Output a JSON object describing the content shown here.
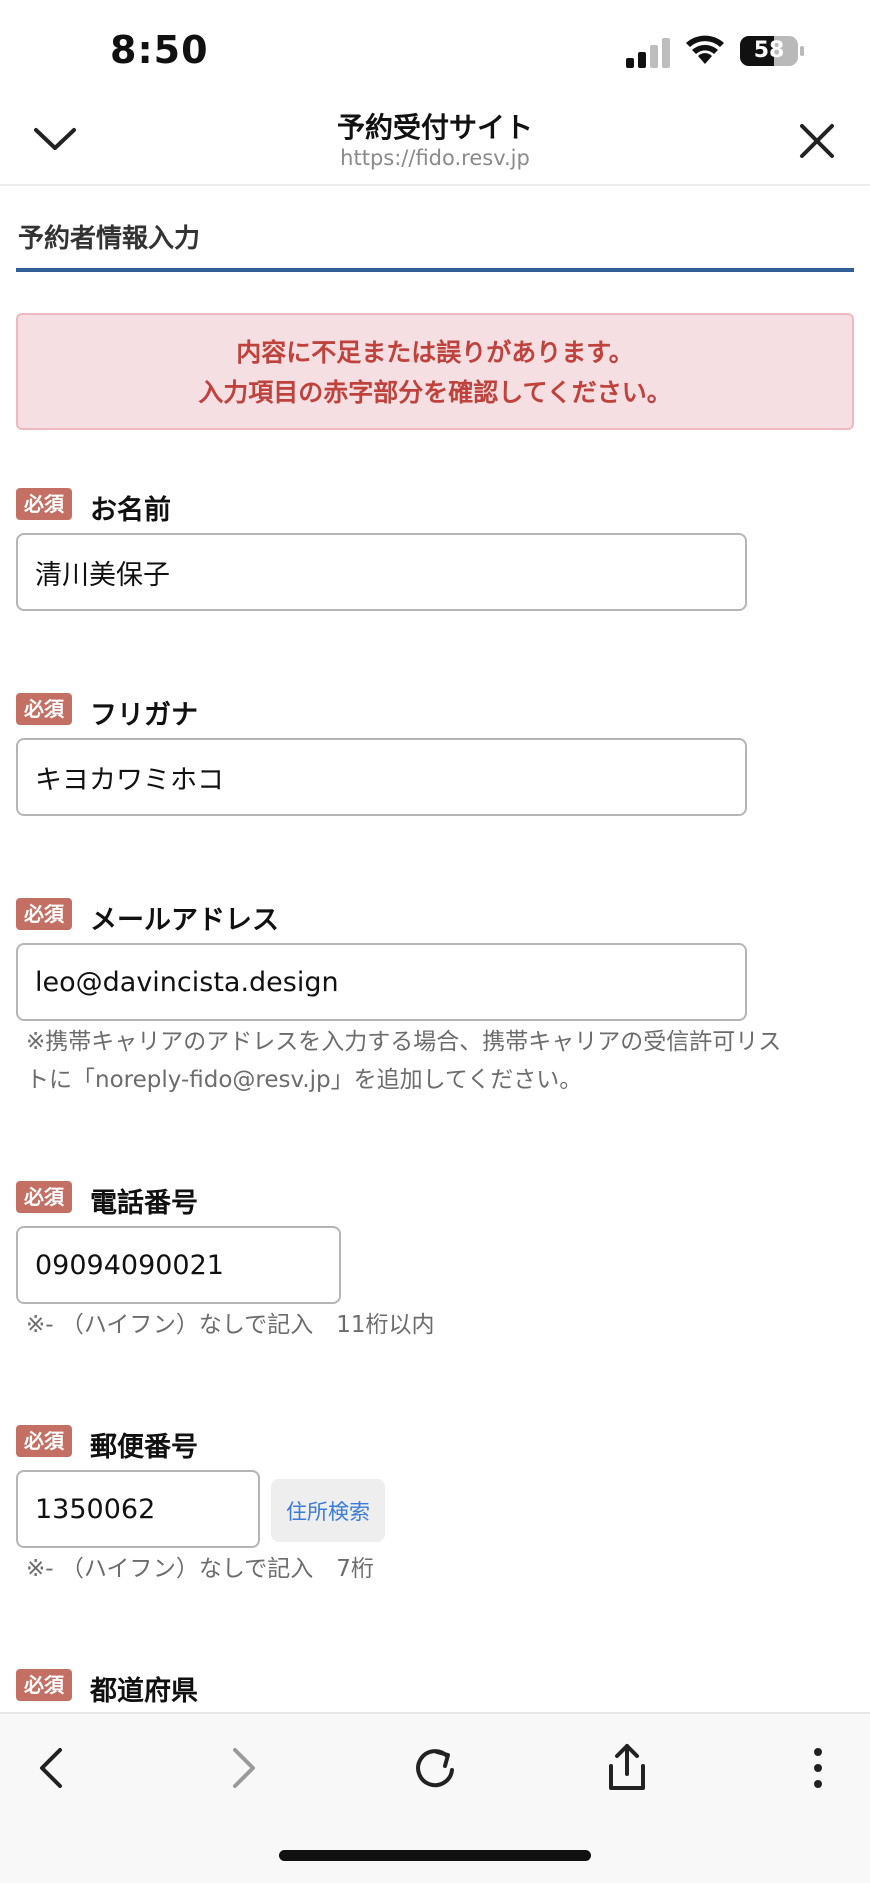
{
  "status_bar": {
    "time": "8:50",
    "battery_level": "58",
    "battery_fraction": 0.58
  },
  "browser_header": {
    "site_title": "予約受付サイト",
    "url": "https://fido.resv.jp"
  },
  "section": {
    "title": "予約者情報入力",
    "accent_color": "#2f5f95"
  },
  "error": {
    "line1": "内容に不足または誤りがあります。",
    "line2": "入力項目の赤字部分を確認してください。",
    "text_color": "#c0423d",
    "background_color": "#f6dfe2"
  },
  "required_badge": "必須",
  "fields": {
    "name": {
      "label": "お名前",
      "value": "清川美保子"
    },
    "furigana": {
      "label": "フリガナ",
      "value": "キヨカワミホコ"
    },
    "email": {
      "label": "メールアドレス",
      "value": "leo@davincista.design",
      "note_line1": "※携帯キャリアのアドレスを入力する場合、携帯キャリアの受信許可リス",
      "note_line2": "トに「noreply-fido@resv.jp」を追加してください。"
    },
    "phone": {
      "label": "電話番号",
      "value": "09094090021",
      "note": "※- （ハイフン）なしで記入　11桁以内"
    },
    "postal": {
      "label": "郵便番号",
      "value": "1350062",
      "search_button": "住所検索",
      "note": "※- （ハイフン）なしで記入　7桁"
    },
    "prefecture": {
      "label": "都道府県"
    }
  },
  "toolbar": {
    "icons": [
      "back-icon",
      "forward-icon",
      "reload-icon",
      "share-icon",
      "more-icon"
    ]
  }
}
